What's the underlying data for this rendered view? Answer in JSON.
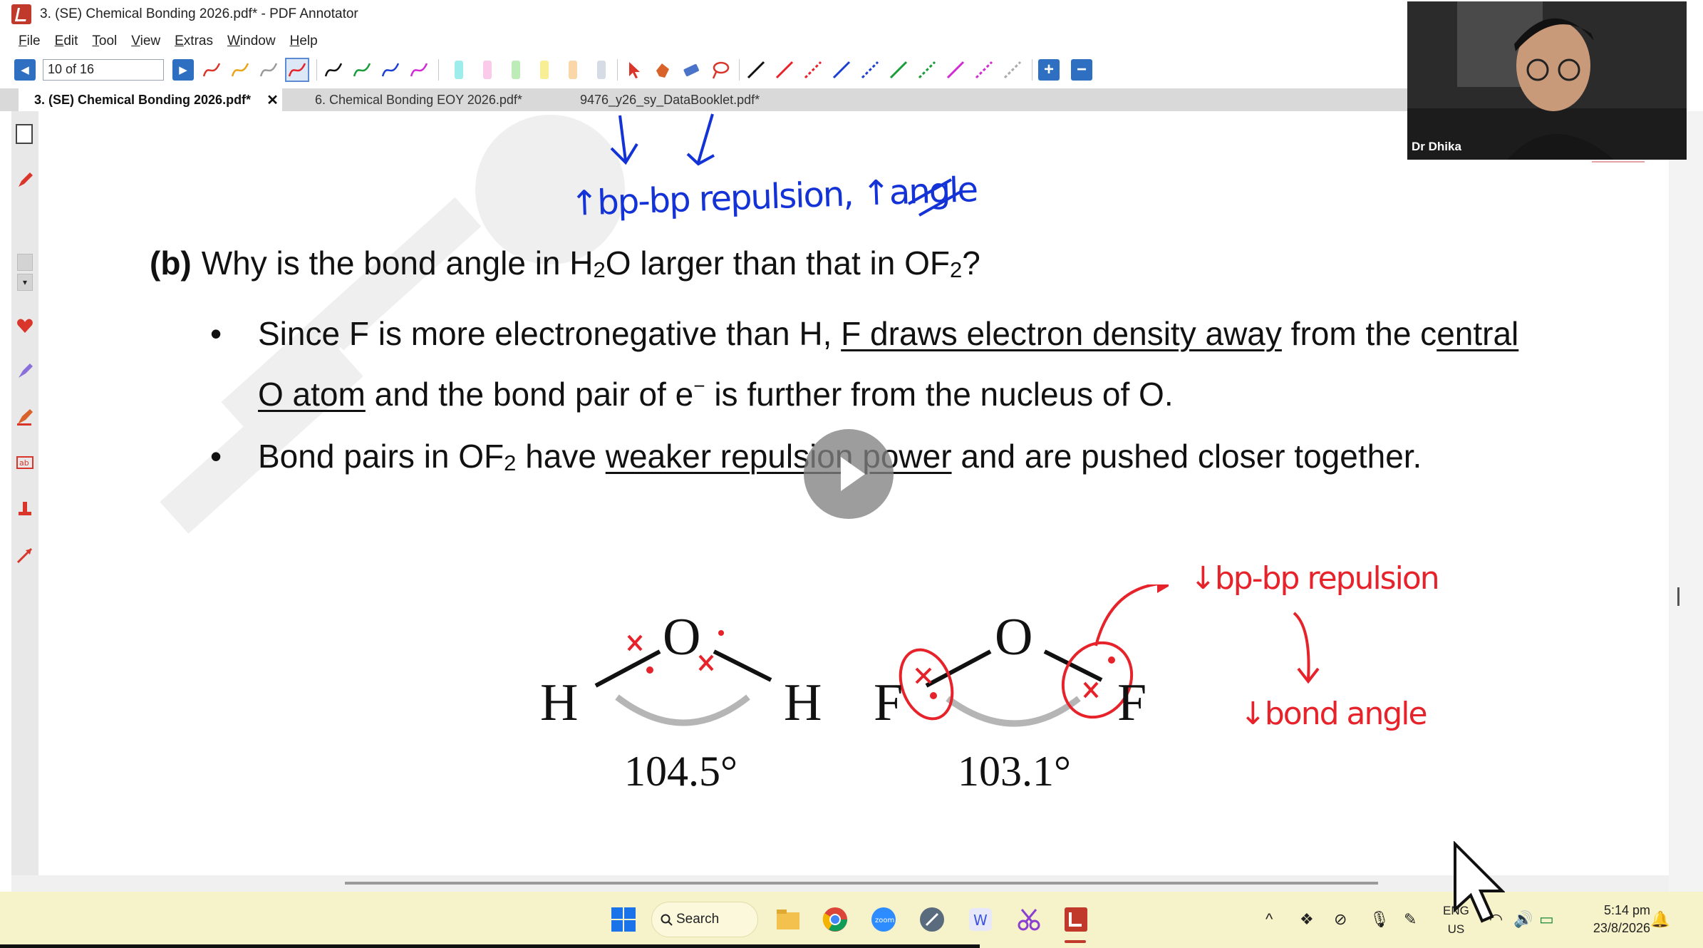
{
  "window": {
    "title": "3. (SE) Chemical Bonding 2026.pdf* - PDF Annotator"
  },
  "menu": [
    "File",
    "Edit",
    "Tool",
    "View",
    "Extras",
    "Window",
    "Help"
  ],
  "toolbar": {
    "page_indicator": "10 of 16"
  },
  "tabs": [
    {
      "label": "3. (SE) Chemical Bonding 2026.pdf*",
      "active": true,
      "close": "✕"
    },
    {
      "label": "6. Chemical Bonding EOY 2026.pdf*",
      "active": false
    },
    {
      "label": "9476_y26_sy_DataBooklet.pdf*",
      "active": false
    }
  ],
  "webcam": {
    "name": "Dr Dhika"
  },
  "page": {
    "handwriting_top": "↑bp-bp repulsion, ↑angle",
    "question": {
      "number": "(b)",
      "text_1": "Why is the bond angle in H",
      "sub_1": "2",
      "text_2": "O larger than that in OF",
      "sub_2": "2",
      "text_3": "?"
    },
    "bullet_1": {
      "a": "Since F is more electronegative than H, ",
      "b": "F draws electron density away",
      "c": " from the c",
      "d": "entral",
      "e": "O atom",
      "f": " and the bond pair of e",
      "g": "−",
      "h": " is further from the nucleus of O."
    },
    "bullet_2": {
      "a": "Bond pairs in OF",
      "sub": "2",
      "b": " have ",
      "c": "weaker repulsion power",
      "d": " and are pushed closer together."
    },
    "diagram": {
      "water": {
        "left_atom": "H",
        "center_atom": "O",
        "right_atom": "H",
        "angle": "104.5°"
      },
      "of2": {
        "left_atom": "F",
        "center_atom": "O",
        "right_atom": "F",
        "angle": "103.1°"
      },
      "annotation_1": "↓bp-bp repulsion",
      "annotation_2": "↓bond angle"
    }
  },
  "taskbar": {
    "search": "Search",
    "lang_1": "ENG",
    "lang_2": "US",
    "time": "5:14 pm",
    "date": "23/8/2026"
  },
  "colors": {
    "accent": "#2e6fc2",
    "ink_blue": "#1433d6",
    "ink_red": "#e6232a",
    "taskbar": "#f6f2c9"
  }
}
